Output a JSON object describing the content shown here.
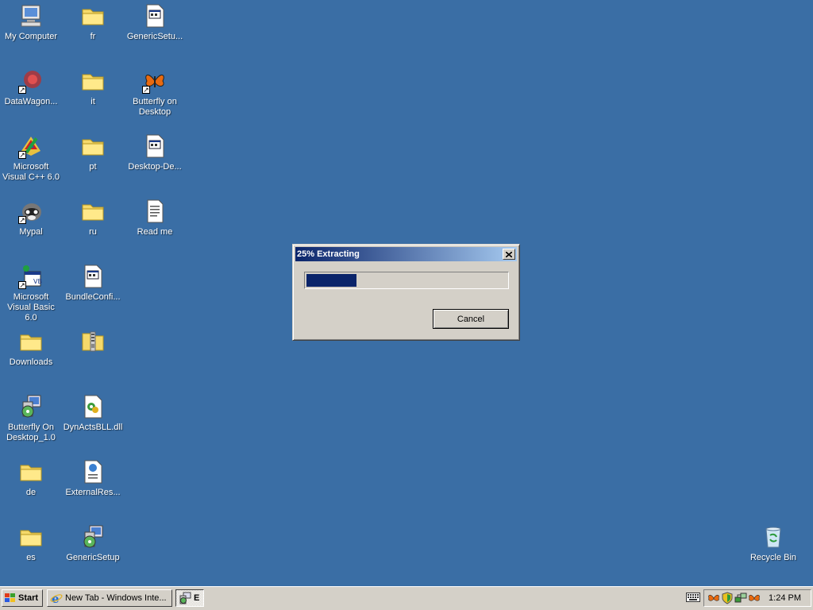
{
  "desktop": {
    "icons": [
      {
        "label": "My Computer",
        "icon": "my-computer-icon"
      },
      {
        "label": "fr",
        "icon": "folder-icon"
      },
      {
        "label": "GenericSetu...",
        "icon": "setup-file-icon"
      },
      {
        "label": "DataWagon...",
        "icon": "datawagon-icon"
      },
      {
        "label": "it",
        "icon": "folder-icon"
      },
      {
        "label": "Butterfly on Desktop",
        "icon": "butterfly-icon"
      },
      {
        "label": "Microsoft Visual C++ 6.0",
        "icon": "visual-cpp-icon"
      },
      {
        "label": "pt",
        "icon": "folder-icon"
      },
      {
        "label": "Desktop-De...",
        "icon": "setup-file-icon"
      },
      {
        "label": "Mypal",
        "icon": "mypal-icon"
      },
      {
        "label": "ru",
        "icon": "folder-icon"
      },
      {
        "label": "Read me",
        "icon": "text-document-icon"
      },
      {
        "label": "Microsoft Visual Basic 6.0",
        "icon": "visual-basic-icon"
      },
      {
        "label": "BundleConfi...",
        "icon": "setup-file-icon"
      },
      {
        "label": "Downloads",
        "icon": "folder-icon"
      },
      {
        "label": "",
        "icon": "zip-folder-icon"
      },
      {
        "label": "Butterfly On Desktop_1.0",
        "icon": "installer-icon"
      },
      {
        "label": "DynActsBLL.dll",
        "icon": "dll-file-icon"
      },
      {
        "label": "de",
        "icon": "folder-icon"
      },
      {
        "label": "ExternalRes...",
        "icon": "web-document-icon"
      },
      {
        "label": "es",
        "icon": "folder-icon"
      },
      {
        "label": "GenericSetup",
        "icon": "installer-icon"
      },
      {
        "label": "Recycle Bin",
        "icon": "recycle-bin-icon"
      }
    ]
  },
  "dialog": {
    "title": "25% Extracting",
    "progress": 0.25,
    "cancel_label": "Cancel",
    "close_icon": "close-icon"
  },
  "taskbar": {
    "start_label": "Start",
    "tasks": [
      {
        "label": "New Tab - Windows Inte...",
        "icon": "internet-explorer-icon"
      },
      {
        "label": "E",
        "icon": "installer-icon"
      }
    ],
    "tray_icons": [
      "keyboard-icon",
      "butterfly-icon",
      "shield-icon",
      "network-icon",
      "butterfly-icon"
    ],
    "clock": "1:24 PM"
  },
  "colors": {
    "desktop": "#3a6ea5",
    "title_start": "#0a246a",
    "title_end": "#a6caf0",
    "progress_fill": "#0a246a",
    "face": "#d4d0c8"
  }
}
